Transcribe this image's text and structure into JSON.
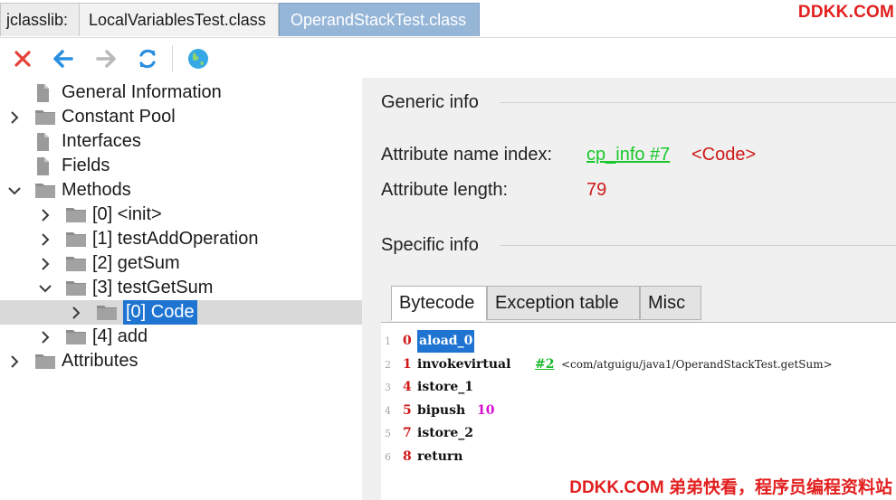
{
  "tabs": {
    "app_label": "jclasslib:",
    "items": [
      "LocalVariablesTest.class",
      "OperandStackTest.class"
    ],
    "active_index": 1
  },
  "watermark_top": "DDKK.COM",
  "watermark_bottom": "DDKK.COM 弟弟快看，程序员编程资料站",
  "toolbar": {
    "buttons": [
      "close-icon",
      "back-arrow-icon",
      "forward-arrow-icon",
      "refresh-icon",
      "web-globe-icon"
    ],
    "colors": {
      "close": "#e5423a",
      "back": "#2a8fe0",
      "forward": "#b9b9b9",
      "refresh": "#2a8fe0",
      "globe": "#35a8e6"
    }
  },
  "tree": {
    "nodes": [
      {
        "label": "General Information",
        "level": 0,
        "twisty": "none",
        "icon": "document-icon"
      },
      {
        "label": "Constant Pool",
        "level": 0,
        "twisty": "collapsed",
        "icon": "folder-icon"
      },
      {
        "label": "Interfaces",
        "level": 0,
        "twisty": "none",
        "icon": "document-icon"
      },
      {
        "label": "Fields",
        "level": 0,
        "twisty": "none",
        "icon": "document-icon"
      },
      {
        "label": "Methods",
        "level": 0,
        "twisty": "expanded",
        "icon": "folder-icon"
      },
      {
        "label": "[0] <init>",
        "level": 1,
        "twisty": "collapsed",
        "icon": "folder-icon"
      },
      {
        "label": "[1] testAddOperation",
        "level": 1,
        "twisty": "collapsed",
        "icon": "folder-icon"
      },
      {
        "label": "[2] getSum",
        "level": 1,
        "twisty": "collapsed",
        "icon": "folder-icon"
      },
      {
        "label": "[3] testGetSum",
        "level": 1,
        "twisty": "expanded",
        "icon": "folder-icon"
      },
      {
        "label": "[0] Code",
        "level": 2,
        "twisty": "collapsed",
        "icon": "folder-icon",
        "selected": true
      },
      {
        "label": "[4] add",
        "level": 1,
        "twisty": "collapsed",
        "icon": "folder-icon"
      },
      {
        "label": "Attributes",
        "level": 0,
        "twisty": "collapsed",
        "icon": "folder-icon"
      }
    ]
  },
  "detail": {
    "generic_heading": "Generic info",
    "name_index_label": "Attribute name index:",
    "name_index_link": "cp_info #7",
    "name_index_value": "<Code>",
    "length_label": "Attribute length:",
    "length_value": "79",
    "specific_heading": "Specific info",
    "subtabs": [
      "Bytecode",
      "Exception table",
      "Misc"
    ],
    "active_subtab": 0
  },
  "bytecode": [
    {
      "line": "1",
      "offset": "0",
      "op": "aload_0",
      "highlight": true
    },
    {
      "line": "2",
      "offset": "1",
      "op": "invokevirtual",
      "link": "#2",
      "comment": "<com/atguigu/java1/OperandStackTest.getSum>"
    },
    {
      "line": "3",
      "offset": "4",
      "op": "istore_1"
    },
    {
      "line": "4",
      "offset": "5",
      "op": "bipush",
      "number": "10"
    },
    {
      "line": "5",
      "offset": "7",
      "op": "istore_2"
    },
    {
      "line": "6",
      "offset": "8",
      "op": "return"
    }
  ]
}
